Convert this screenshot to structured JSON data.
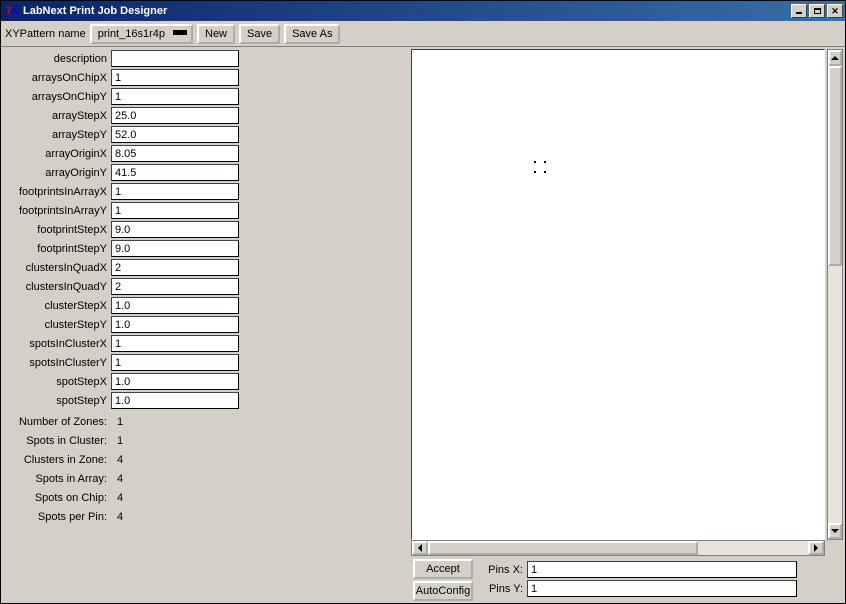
{
  "window": {
    "title": "LabNext Print Job Designer"
  },
  "toolbar": {
    "pattern_label": "XYPattern name",
    "pattern_value": "print_16s1r4p",
    "new_label": "New",
    "save_label": "Save",
    "saveas_label": "Save As"
  },
  "fields": [
    {
      "label": "description",
      "value": ""
    },
    {
      "label": "arraysOnChipX",
      "value": "1"
    },
    {
      "label": "arraysOnChipY",
      "value": "1"
    },
    {
      "label": "arrayStepX",
      "value": "25.0"
    },
    {
      "label": "arrayStepY",
      "value": "52.0"
    },
    {
      "label": "arrayOriginX",
      "value": "8.05"
    },
    {
      "label": "arrayOriginY",
      "value": "41.5"
    },
    {
      "label": "footprintsInArrayX",
      "value": "1"
    },
    {
      "label": "footprintsInArrayY",
      "value": "1"
    },
    {
      "label": "footprintStepX",
      "value": "9.0"
    },
    {
      "label": "footprintStepY",
      "value": "9.0"
    },
    {
      "label": "clustersInQuadX",
      "value": "2"
    },
    {
      "label": "clustersInQuadY",
      "value": "2"
    },
    {
      "label": "clusterStepX",
      "value": "1.0"
    },
    {
      "label": "clusterStepY",
      "value": "1.0"
    },
    {
      "label": "spotsInClusterX",
      "value": "1"
    },
    {
      "label": "spotsInClusterY",
      "value": "1"
    },
    {
      "label": "spotStepX",
      "value": "1.0"
    },
    {
      "label": "spotStepY",
      "value": "1.0"
    }
  ],
  "stats": [
    {
      "label": "Number of Zones:",
      "value": "1"
    },
    {
      "label": "Spots in Cluster:",
      "value": "1"
    },
    {
      "label": "Clusters in Zone:",
      "value": "4"
    },
    {
      "label": "Spots in Array:",
      "value": "4"
    },
    {
      "label": "Spots on Chip:",
      "value": "4"
    },
    {
      "label": "Spots per Pin:",
      "value": "4"
    }
  ],
  "buttons": {
    "accept": "Accept",
    "autoconfig": "AutoConfig"
  },
  "pins": {
    "x_label": "Pins X:",
    "x_value": "1",
    "y_label": "Pins Y:",
    "y_value": "1"
  }
}
